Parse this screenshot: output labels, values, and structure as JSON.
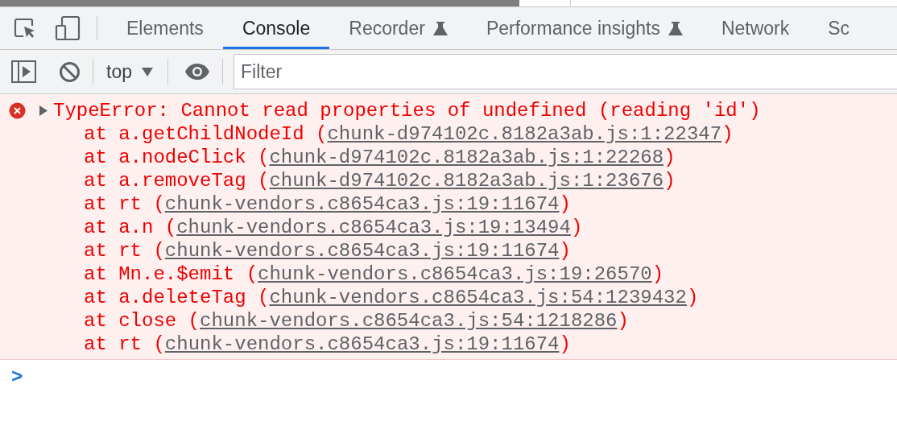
{
  "tabs": [
    {
      "label": "Elements",
      "selected": false,
      "experimental": false
    },
    {
      "label": "Console",
      "selected": true,
      "experimental": false
    },
    {
      "label": "Recorder",
      "selected": false,
      "experimental": true
    },
    {
      "label": "Performance insights",
      "selected": false,
      "experimental": true
    },
    {
      "label": "Network",
      "selected": false,
      "experimental": false
    },
    {
      "label": "Sc",
      "selected": false,
      "experimental": false
    }
  ],
  "toolbar": {
    "context": "top",
    "filter_placeholder": "Filter"
  },
  "error": {
    "expanded": false,
    "message": "TypeError: Cannot read properties of undefined (reading 'id')",
    "frames": [
      {
        "prefix": "at a.getChildNodeId (",
        "link": "chunk-d974102c.8182a3ab.js:1:22347",
        "suffix": ")"
      },
      {
        "prefix": "at a.nodeClick (",
        "link": "chunk-d974102c.8182a3ab.js:1:22268",
        "suffix": ")"
      },
      {
        "prefix": "at a.removeTag (",
        "link": "chunk-d974102c.8182a3ab.js:1:23676",
        "suffix": ")"
      },
      {
        "prefix": "at rt (",
        "link": "chunk-vendors.c8654ca3.js:19:11674",
        "suffix": ")"
      },
      {
        "prefix": "at a.n (",
        "link": "chunk-vendors.c8654ca3.js:19:13494",
        "suffix": ")"
      },
      {
        "prefix": "at rt (",
        "link": "chunk-vendors.c8654ca3.js:19:11674",
        "suffix": ")"
      },
      {
        "prefix": "at Mn.e.$emit (",
        "link": "chunk-vendors.c8654ca3.js:19:26570",
        "suffix": ")"
      },
      {
        "prefix": "at a.deleteTag (",
        "link": "chunk-vendors.c8654ca3.js:54:1239432",
        "suffix": ")"
      },
      {
        "prefix": "at close (",
        "link": "chunk-vendors.c8654ca3.js:54:1218286",
        "suffix": ")"
      },
      {
        "prefix": "at rt (",
        "link": "chunk-vendors.c8654ca3.js:19:11674",
        "suffix": ")"
      }
    ]
  },
  "prompt": ">"
}
